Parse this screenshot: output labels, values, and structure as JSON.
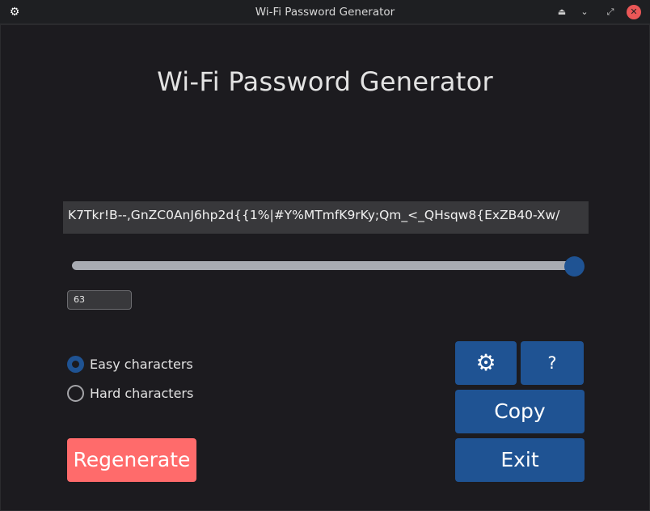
{
  "window": {
    "title": "Wi-Fi Password Generator",
    "icons": [
      "gear-icon",
      "minimize-icon",
      "chevron-down-icon",
      "maximize-icon",
      "close-icon"
    ]
  },
  "main": {
    "heading": "Wi-Fi Password Generator",
    "password": "K7Tkr!B--,GnZC0AnJ6hp2d{{1%|#Y%MTmfK9rKy;Qm_<_QHsqw8{ExZB40-Xw/",
    "length_value": "63",
    "slider_fraction": 1.0,
    "options": {
      "easy_label": "Easy characters",
      "hard_label": "Hard characters",
      "selected": "easy"
    },
    "buttons": {
      "settings_icon": "⚙",
      "help_label": "?",
      "copy_label": "Copy",
      "exit_label": "Exit",
      "regenerate_label": "Regenerate"
    }
  },
  "colors": {
    "accent": "#1f5393",
    "regenerate": "#ff6b6b",
    "background": "#1c1b1f",
    "field": "#38383b"
  }
}
